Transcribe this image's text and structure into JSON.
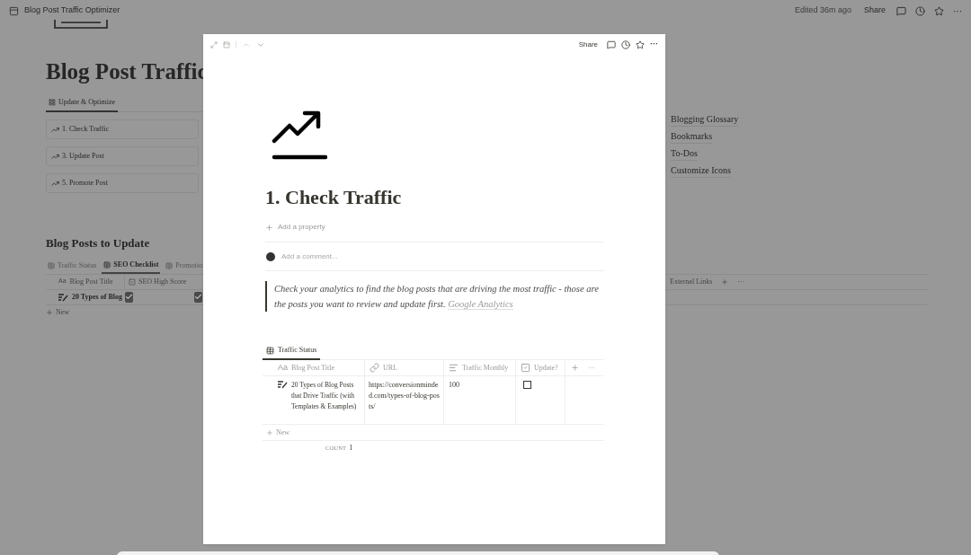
{
  "app_bar": {
    "title": "Blog Post Traffic Optimizer",
    "edited": "Edited 36m ago",
    "share": "Share"
  },
  "page": {
    "title": "Blog Post Traffic",
    "view_tabs": [
      {
        "label": "Update & Optimize",
        "selected": true
      }
    ],
    "cards": [
      "1. Check Traffic",
      "3. Update Post",
      "5. Promote Post"
    ],
    "links": [
      "Blogging Glossary",
      "Bookmarks",
      "To-Dos",
      "Customize Icons"
    ],
    "database": {
      "title": "Blog Posts to Update",
      "views": [
        {
          "label": "Traffic Status",
          "selected": false
        },
        {
          "label": "SEO Checklist",
          "selected": true
        },
        {
          "label": "Promotio",
          "selected": false
        }
      ],
      "title_type": "Aa",
      "columns": [
        "Blog Post Title",
        "SEO High Score"
      ],
      "right_column": "External Links",
      "more": "···",
      "rows": [
        {
          "title": "20 Types of Blog",
          "checks": [
            true,
            true
          ]
        }
      ],
      "new_label": "New"
    }
  },
  "peek": {
    "share": "Share",
    "more": "···",
    "title": "1. Check Traffic",
    "add_property": "Add a property",
    "comment_placeholder": "Add a comment...",
    "quote": {
      "text": "Check your analytics to find the blog posts that are driving the most traffic - those are the posts you want to review and update first.",
      "link": "Google Analytics"
    },
    "database": {
      "views": [
        {
          "label": "Traffic Status",
          "selected": true
        }
      ],
      "title_type": "Aa",
      "columns": [
        {
          "label": "Blog Post Title",
          "kind": "title"
        },
        {
          "label": "URL",
          "kind": "url"
        },
        {
          "label": "Traffic Monthly",
          "kind": "text"
        },
        {
          "label": "Update?",
          "kind": "checkbox"
        }
      ],
      "more": "···",
      "rows": [
        {
          "title": "20 Types of Blog Posts that Drive Traffic (with Templates & Examples)",
          "url": "https://conversionminded.com/types-of-blog-posts/",
          "traffic": "100",
          "update": false
        }
      ],
      "new_label": "New",
      "count_label": "COUNT",
      "count": "1"
    }
  }
}
